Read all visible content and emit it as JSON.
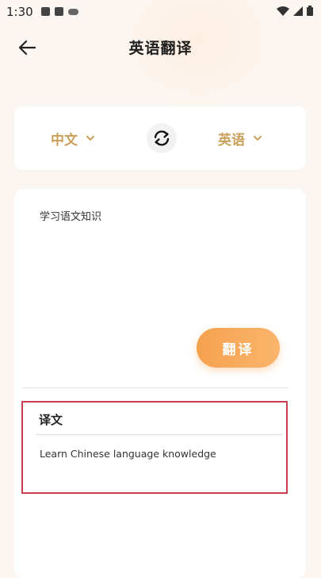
{
  "status_bar": {
    "time": "1:30"
  },
  "header": {
    "title": "英语翻译"
  },
  "languages": {
    "source": "中文",
    "target": "英语"
  },
  "input": {
    "text": "学习语文知识"
  },
  "actions": {
    "translate_label": "翻译"
  },
  "result": {
    "title": "译文",
    "text": "Learn Chinese language knowledge"
  },
  "colors": {
    "accent": "#f5a14e",
    "language_label": "#c9a05a",
    "highlight_border": "#c6414f",
    "background": "#fbf6f1"
  }
}
